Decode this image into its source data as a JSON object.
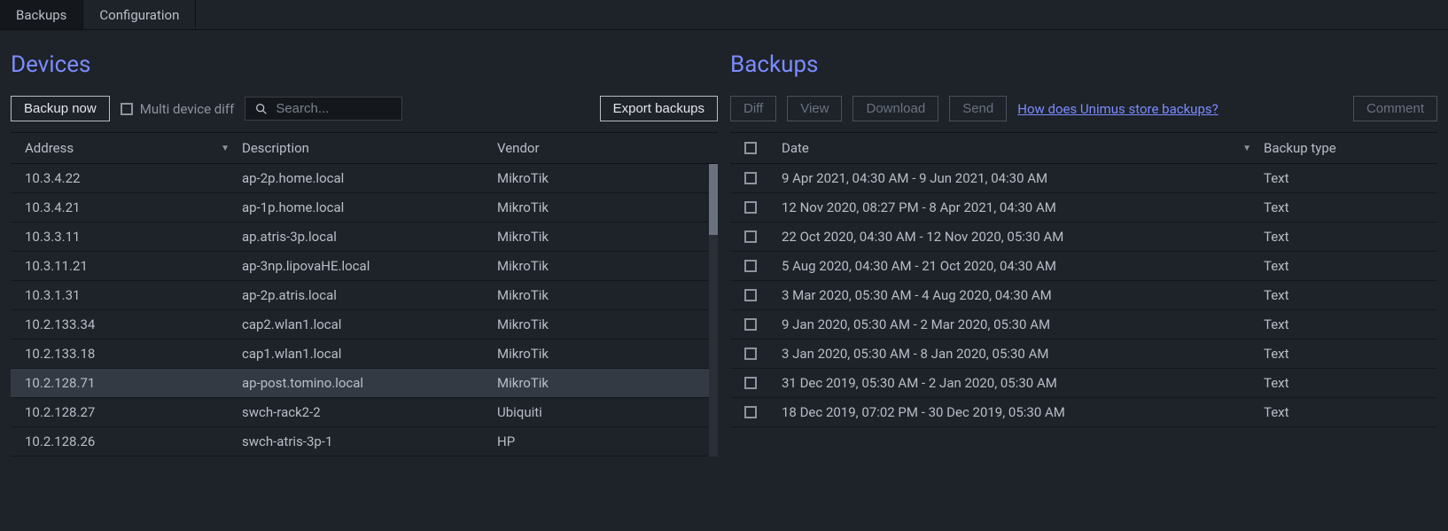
{
  "tabs": {
    "backups": "Backups",
    "configuration": "Configuration"
  },
  "devices": {
    "title": "Devices",
    "toolbar": {
      "backup_now": "Backup now",
      "multi_device_diff": "Multi device diff",
      "search_placeholder": "Search...",
      "export_backups": "Export backups"
    },
    "headers": {
      "address": "Address",
      "description": "Description",
      "vendor": "Vendor"
    },
    "rows": [
      {
        "address": "10.3.4.22",
        "description": "ap-2p.home.local",
        "vendor": "MikroTik",
        "selected": false
      },
      {
        "address": "10.3.4.21",
        "description": "ap-1p.home.local",
        "vendor": "MikroTik",
        "selected": false
      },
      {
        "address": "10.3.3.11",
        "description": "ap.atris-3p.local",
        "vendor": "MikroTik",
        "selected": false
      },
      {
        "address": "10.3.11.21",
        "description": "ap-3np.lipovaHE.local",
        "vendor": "MikroTik",
        "selected": false
      },
      {
        "address": "10.3.1.31",
        "description": "ap-2p.atris.local",
        "vendor": "MikroTik",
        "selected": false
      },
      {
        "address": "10.2.133.34",
        "description": "cap2.wlan1.local",
        "vendor": "MikroTik",
        "selected": false
      },
      {
        "address": "10.2.133.18",
        "description": "cap1.wlan1.local",
        "vendor": "MikroTik",
        "selected": false
      },
      {
        "address": "10.2.128.71",
        "description": "ap-post.tomino.local",
        "vendor": "MikroTik",
        "selected": true
      },
      {
        "address": "10.2.128.27",
        "description": "swch-rack2-2",
        "vendor": "Ubiquiti",
        "selected": false
      },
      {
        "address": "10.2.128.26",
        "description": "swch-atris-3p-1",
        "vendor": "HP",
        "selected": false
      }
    ]
  },
  "backups": {
    "title": "Backups",
    "toolbar": {
      "diff": "Diff",
      "view": "View",
      "download": "Download",
      "send": "Send",
      "help_link": "How does Unimus store backups?",
      "comment": "Comment"
    },
    "headers": {
      "date": "Date",
      "backup_type": "Backup type"
    },
    "rows": [
      {
        "date": "9 Apr 2021, 04:30 AM - 9 Jun 2021, 04:30 AM",
        "type": "Text"
      },
      {
        "date": "12 Nov 2020, 08:27 PM - 8 Apr 2021, 04:30 AM",
        "type": "Text"
      },
      {
        "date": "22 Oct 2020, 04:30 AM - 12 Nov 2020, 05:30 AM",
        "type": "Text"
      },
      {
        "date": "5 Aug 2020, 04:30 AM - 21 Oct 2020, 04:30 AM",
        "type": "Text"
      },
      {
        "date": "3 Mar 2020, 05:30 AM - 4 Aug 2020, 04:30 AM",
        "type": "Text"
      },
      {
        "date": "9 Jan 2020, 05:30 AM - 2 Mar 2020, 05:30 AM",
        "type": "Text"
      },
      {
        "date": "3 Jan 2020, 05:30 AM - 8 Jan 2020, 05:30 AM",
        "type": "Text"
      },
      {
        "date": "31 Dec 2019, 05:30 AM - 2 Jan 2020, 05:30 AM",
        "type": "Text"
      },
      {
        "date": "18 Dec 2019, 07:02 PM - 30 Dec 2019, 05:30 AM",
        "type": "Text"
      }
    ]
  }
}
